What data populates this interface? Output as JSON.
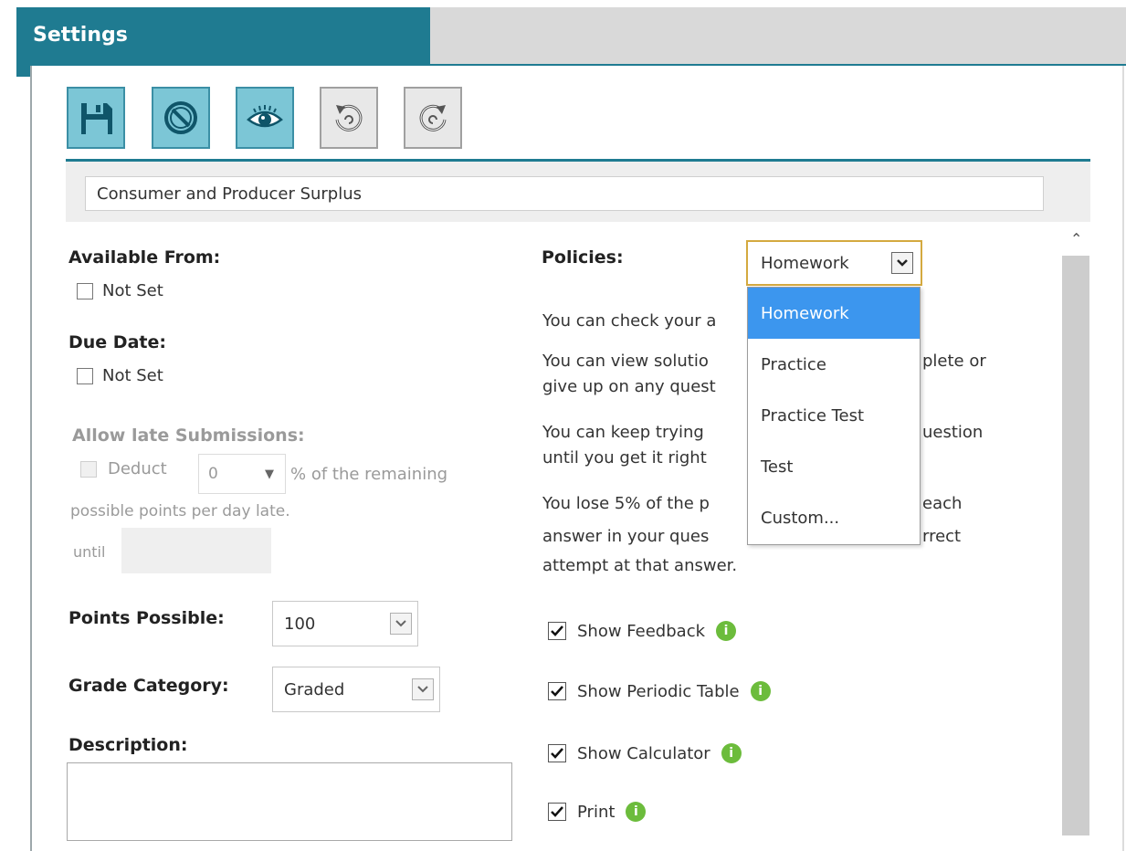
{
  "window": {
    "title": "Settings"
  },
  "toolbar": {
    "buttons": [
      {
        "name": "save",
        "icon": "floppy-disk-icon",
        "active": true
      },
      {
        "name": "cancel",
        "icon": "prohibited-icon",
        "active": true
      },
      {
        "name": "preview",
        "icon": "eye-icon",
        "active": true
      },
      {
        "name": "undo",
        "icon": "undo-icon",
        "active": false
      },
      {
        "name": "redo",
        "icon": "redo-icon",
        "active": false
      }
    ]
  },
  "assignment": {
    "title": "Consumer and Producer Surplus"
  },
  "left": {
    "available_from": {
      "label": "Available From:",
      "checkbox_label": "Not Set",
      "checked": false
    },
    "due_date": {
      "label": "Due Date:",
      "checkbox_label": "Not Set",
      "checked": false
    },
    "late": {
      "label": "Allow late Submissions:",
      "deduct_label": "Deduct",
      "deduct_value": "0",
      "after_select": "% of the remaining",
      "line2": "possible points per day late.",
      "until": "until"
    },
    "points": {
      "label": "Points Possible:",
      "value": "100"
    },
    "grade_category": {
      "label": "Grade Category:",
      "value": "Graded"
    },
    "description": {
      "label": "Description:",
      "value": ""
    }
  },
  "right": {
    "policies": {
      "label": "Policies:",
      "selected": "Homework",
      "options": [
        "Homework",
        "Practice",
        "Practice Test",
        "Test",
        "Custom..."
      ]
    },
    "paragraph_lines": [
      {
        "l1": "You can check your a",
        "l1b": ""
      },
      {
        "l1": "You can view solutio",
        "l1b": "plete or",
        "l2": "give up on any quest"
      },
      {
        "l1": "You can keep trying",
        "l1b": "uestion",
        "l2": "until you get it right"
      },
      {
        "l1": "You lose 5% of the p",
        "l1b": "each",
        "l2": "answer in your ques",
        "l2b": "rrect",
        "l3": "attempt at that answer."
      }
    ],
    "options": [
      {
        "label": "Show Feedback",
        "checked": true
      },
      {
        "label": "Show Periodic Table",
        "checked": true
      },
      {
        "label": "Show Calculator",
        "checked": true
      },
      {
        "label": "Print",
        "checked": true
      }
    ]
  },
  "colors": {
    "accent": "#1f7b91",
    "tool_active": "#7cc6d6",
    "dropdown_highlight": "#3c96ee",
    "info": "#6cbc3c"
  }
}
